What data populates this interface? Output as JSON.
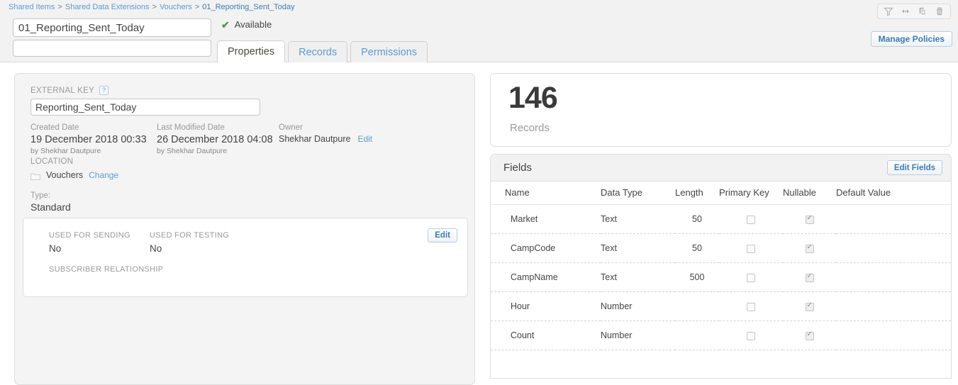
{
  "breadcrumb": {
    "items": [
      "Shared Items",
      "Shared Data Extensions",
      "Vouchers"
    ],
    "current": "01_Reporting_Sent_Today",
    "separator": ">"
  },
  "header": {
    "name_value": "01_Reporting_Sent_Today",
    "name_placeholder": "",
    "description_value": "",
    "description_placeholder": "",
    "status_text": "Available",
    "status_icon": "check-icon",
    "status_color": "#4a9e3f",
    "manage_policies_label": "Manage Policies",
    "toolbar_icons": [
      {
        "name": "filter-icon",
        "title": "Filter"
      },
      {
        "name": "move-icon",
        "title": "Move"
      },
      {
        "name": "copy-icon",
        "title": "Copy"
      },
      {
        "name": "delete-icon",
        "title": "Delete"
      }
    ]
  },
  "tabs": [
    {
      "label": "Properties",
      "active": true
    },
    {
      "label": "Records",
      "active": false
    },
    {
      "label": "Permissions",
      "active": false
    }
  ],
  "properties": {
    "external_key_label": "EXTERNAL KEY",
    "external_key_help": "?",
    "external_key_value": "Reporting_Sent_Today",
    "created_date_label": "Created Date",
    "created_date_value": "19 December 2018 00:33",
    "created_by": "by Shekhar Dautpure",
    "last_modified_label": "Last Modified Date",
    "last_modified_value": "26 December 2018 04:08",
    "last_modified_by": "by Shekhar Dautpure",
    "owner_label": "Owner",
    "owner_value": "Shekhar Dautpure",
    "owner_edit_label": "Edit",
    "location_label": "LOCATION",
    "location_icon": "folder-icon",
    "location_value": "Vouchers",
    "location_change_label": "Change",
    "type_label": "Type:",
    "type_value": "Standard"
  },
  "sending_card": {
    "used_for_sending_label": "USED FOR SENDING",
    "used_for_sending_value": "No",
    "used_for_testing_label": "USED FOR TESTING",
    "used_for_testing_value": "No",
    "subscriber_relationship_label": "SUBSCRIBER RELATIONSHIP",
    "edit_label": "Edit"
  },
  "records_card": {
    "count": "146",
    "label": "Records"
  },
  "fields": {
    "title": "Fields",
    "edit_fields_label": "Edit Fields",
    "columns": [
      "Name",
      "Data Type",
      "Length",
      "Primary Key",
      "Nullable",
      "Default Value"
    ],
    "rows": [
      {
        "name": "Market",
        "type": "Text",
        "length": "50",
        "primary_key": false,
        "nullable": true,
        "default": ""
      },
      {
        "name": "CampCode",
        "type": "Text",
        "length": "50",
        "primary_key": false,
        "nullable": true,
        "default": ""
      },
      {
        "name": "CampName",
        "type": "Text",
        "length": "500",
        "primary_key": false,
        "nullable": true,
        "default": ""
      },
      {
        "name": "Hour",
        "type": "Number",
        "length": "",
        "primary_key": false,
        "nullable": true,
        "default": ""
      },
      {
        "name": "Count",
        "type": "Number",
        "length": "",
        "primary_key": false,
        "nullable": true,
        "default": ""
      }
    ]
  }
}
